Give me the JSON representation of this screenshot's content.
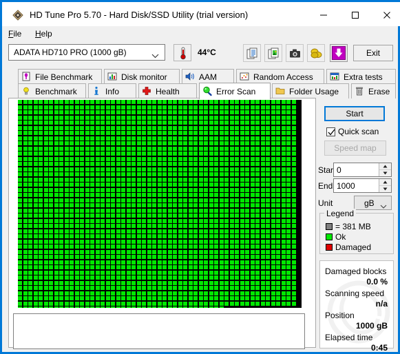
{
  "window": {
    "title": "HD Tune Pro 5.70 - Hard Disk/SSD Utility (trial version)",
    "app_icon": "hdtune-logo-icon",
    "accent_color": "#0078d7",
    "controls": {
      "minimize": "minimize-icon",
      "maximize": "maximize-icon",
      "close": "close-icon"
    }
  },
  "menubar": {
    "items": [
      {
        "label": "File",
        "mnemonic": "F"
      },
      {
        "label": "Help",
        "mnemonic": "H"
      }
    ]
  },
  "toolbar": {
    "drive": {
      "value": "ADATA   HD710 PRO (1000 gB)",
      "arrow_icon": "chevron-down-icon"
    },
    "temperature": {
      "icon": "thermometer-icon",
      "value": "44°C"
    },
    "buttons": [
      {
        "name": "copy-text-button",
        "icon": "copy-text-icon"
      },
      {
        "name": "copy-image-button",
        "icon": "copy-image-icon"
      },
      {
        "name": "screenshot-button",
        "icon": "camera-icon"
      },
      {
        "name": "coins-button",
        "icon": "coins-icon"
      },
      {
        "name": "download-button",
        "icon": "download-arrow-icon"
      }
    ],
    "exit_label": "Exit"
  },
  "tabs": {
    "top_row": [
      {
        "label": "File Benchmark",
        "icon": "file-benchmark-icon",
        "active": false
      },
      {
        "label": "Disk monitor",
        "icon": "bar-chart-icon",
        "active": false
      },
      {
        "label": "AAM",
        "icon": "speaker-icon",
        "active": false
      },
      {
        "label": "Random Access",
        "icon": "scatter-icon",
        "active": false
      },
      {
        "label": "Extra tests",
        "icon": "extra-tests-icon",
        "active": false
      }
    ],
    "bottom_row": [
      {
        "label": "Benchmark",
        "icon": "lightbulb-icon",
        "active": false
      },
      {
        "label": "Info",
        "icon": "info-icon",
        "active": false
      },
      {
        "label": "Health",
        "icon": "red-cross-icon",
        "active": false
      },
      {
        "label": "Error Scan",
        "icon": "magnifier-icon",
        "active": true
      },
      {
        "label": "Folder Usage",
        "icon": "folder-icon",
        "active": false
      },
      {
        "label": "Erase",
        "icon": "trash-icon",
        "active": false
      }
    ]
  },
  "scan": {
    "grid": {
      "columns": 55,
      "rows": 40,
      "ok_color": "#00e800",
      "damaged_color": "#e00000",
      "unscanned_color": "#808080",
      "background_color": "#000000",
      "block_size_label": "381 MB"
    },
    "log_text": ""
  },
  "controls": {
    "start_label": "Start",
    "quick_scan": {
      "label": "Quick scan",
      "checked": true,
      "check_icon": "checkmark-icon"
    },
    "speed_map": {
      "label": "Speed map",
      "enabled": false
    },
    "start_field": {
      "label": "Start",
      "value": "0"
    },
    "end_field": {
      "label": "End",
      "value": "1000"
    },
    "unit_field": {
      "label": "Unit",
      "value": "gB",
      "arrow_icon": "chevron-down-icon"
    },
    "spinner_up_icon": "spinner-up-icon",
    "spinner_down_icon": "spinner-down-icon"
  },
  "legend": {
    "title": "Legend",
    "block_size": "= 381 MB",
    "block_color": "#808080",
    "ok_label": "Ok",
    "ok_color": "#00e800",
    "damaged_label": "Damaged",
    "damaged_color": "#e00000"
  },
  "stats": {
    "damaged_blocks": {
      "label": "Damaged blocks",
      "value": "0.0 %"
    },
    "scanning_speed": {
      "label": "Scanning speed",
      "value": "n/a"
    },
    "position": {
      "label": "Position",
      "value": "1000 gB"
    },
    "elapsed_time": {
      "label": "Elapsed time",
      "value": "0:45"
    }
  }
}
